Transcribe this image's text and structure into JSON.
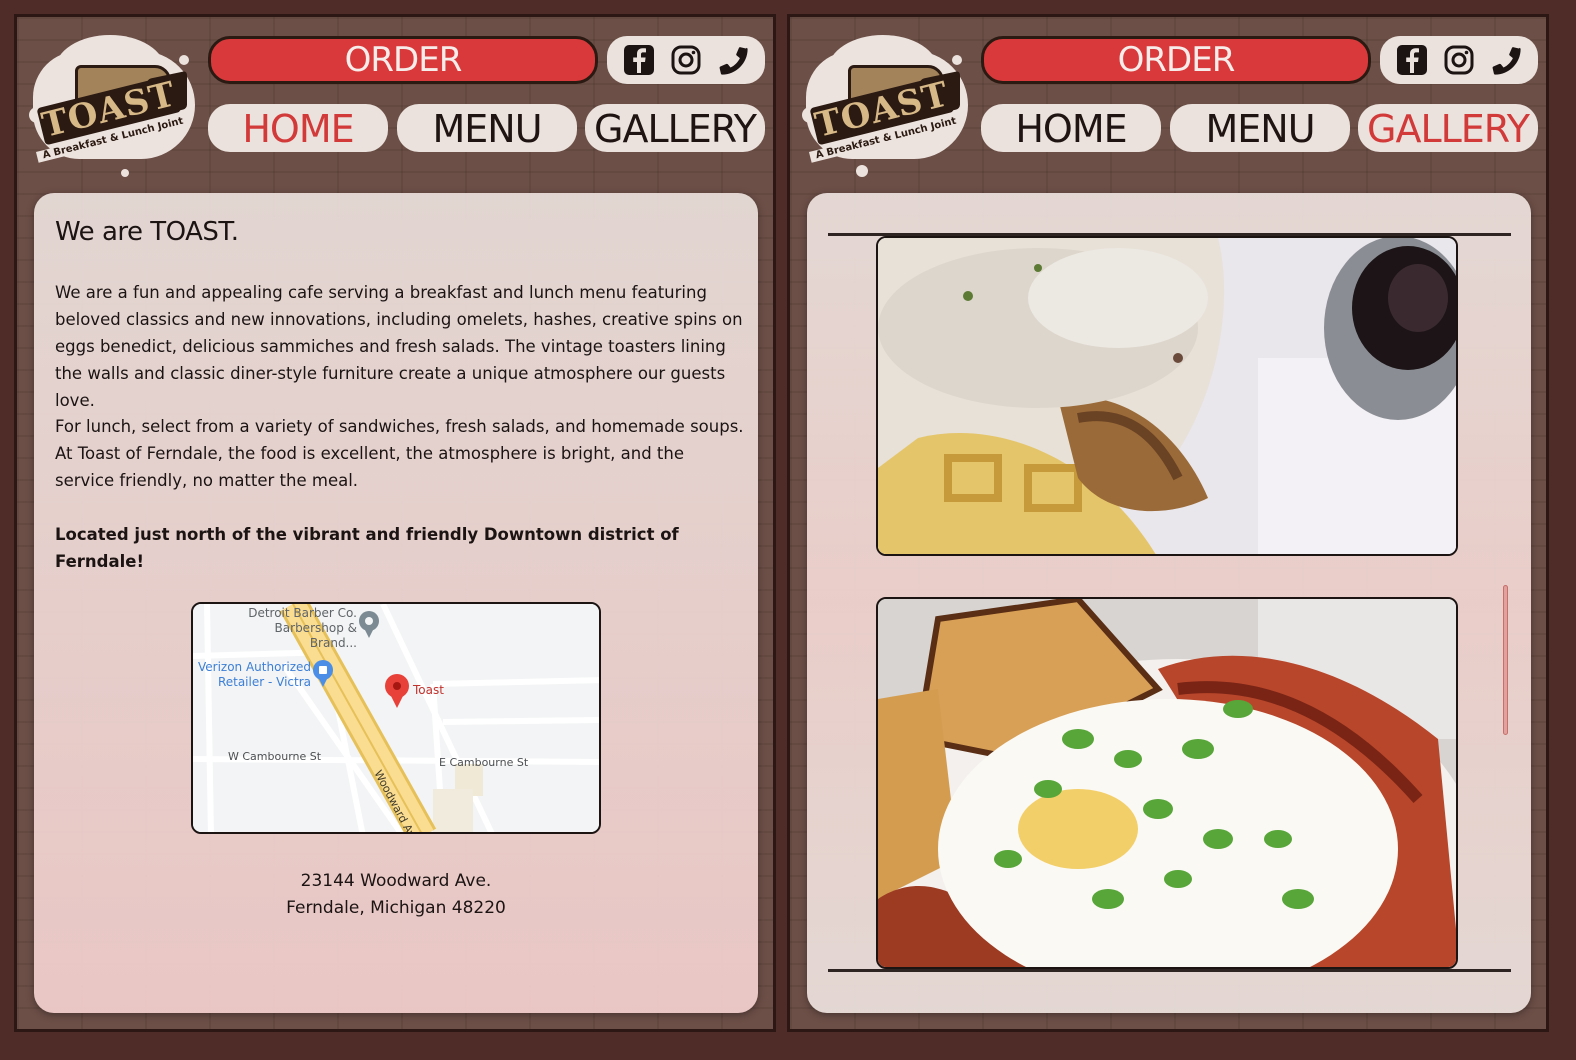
{
  "brand": {
    "name": "TOAST",
    "tagline": "A Breakfast & Lunch Joint"
  },
  "header": {
    "order_label": "ORDER",
    "social_icons": [
      "facebook-icon",
      "instagram-icon",
      "phone-icon"
    ],
    "nav": [
      {
        "label": "HOME"
      },
      {
        "label": "MENU"
      },
      {
        "label": "GALLERY"
      }
    ]
  },
  "left_page": {
    "active_nav": "HOME",
    "heading": "We are TOAST.",
    "paragraphs": [
      "We are a fun and appealing cafe serving a breakfast and lunch menu featuring beloved classics and new innovations, including omelets, hashes, creative spins on eggs benedict, delicious sammiches and fresh salads. The vintage toasters lining the walls and classic diner-style furniture create a unique atmosphere our guests love.",
      "For lunch, select from a variety of sandwiches, fresh salads, and homemade soups. At Toast of Ferndale, the food is excellent, the atmosphere is bright, and the service friendly, no matter the meal.",
      "Located just north of the vibrant and friendly Downtown district of Ferndale!"
    ],
    "map": {
      "labels": {
        "barber_line1": "Detroit Barber Co.",
        "barber_line2": "Barbershop & Brand...",
        "verizon_line1": "Verizon Authorized",
        "verizon_line2": "Retailer - Victra",
        "toast": "Toast",
        "w_street": "W Cambourne St",
        "e_street": "E Cambourne St",
        "avenue": "Woodward Ave"
      }
    },
    "address_line1": "23144 Woodward Ave.",
    "address_line2": "Ferndale, Michigan 48220"
  },
  "right_page": {
    "active_nav": "GALLERY",
    "photos": [
      {
        "name": "chicken-and-waffles-photo"
      },
      {
        "name": "eggs-and-hash-photo"
      }
    ]
  },
  "colors": {
    "accent_red": "#d9393a",
    "dark_brown": "#2b1a12",
    "cream": "#ebe2dd"
  }
}
